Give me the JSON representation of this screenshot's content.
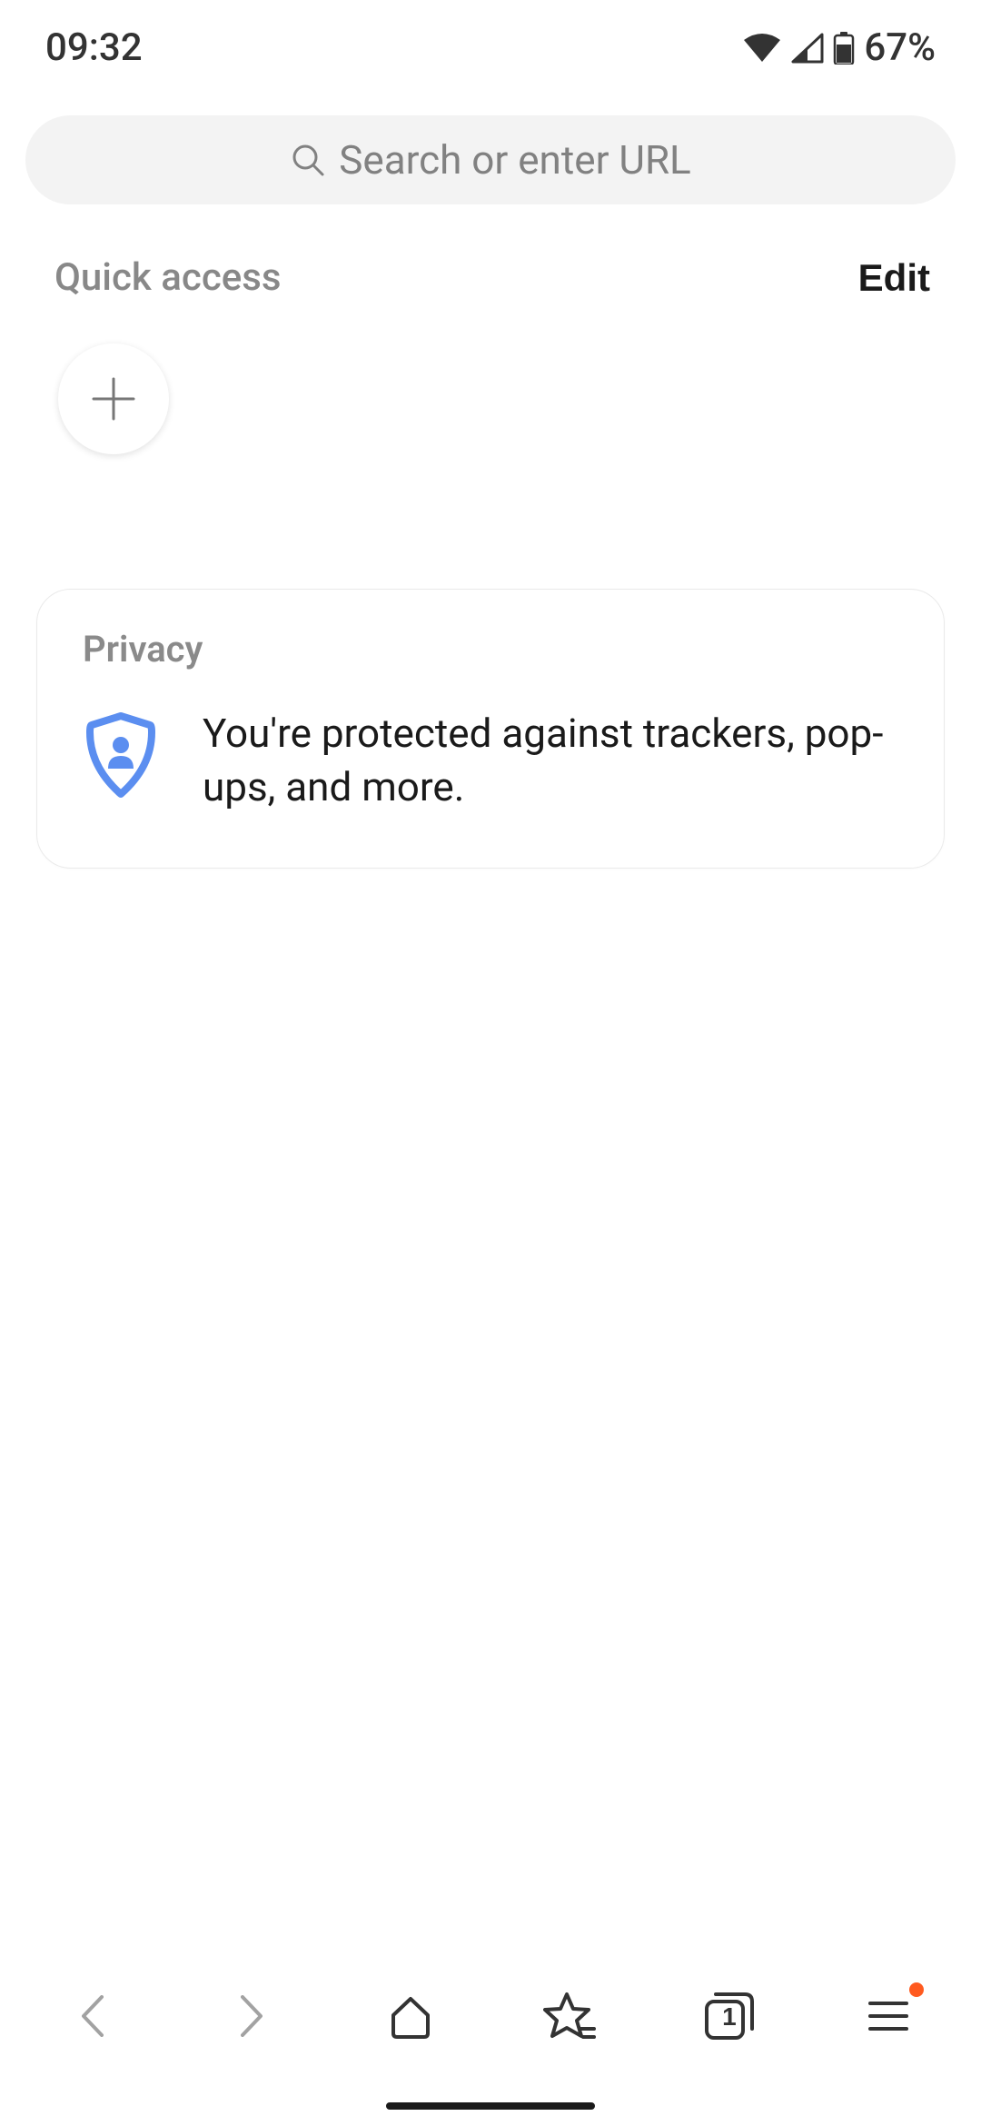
{
  "status": {
    "time": "09:32",
    "battery": "67%"
  },
  "search": {
    "placeholder": "Search or enter URL"
  },
  "quick_access": {
    "title": "Quick access",
    "edit_label": "Edit"
  },
  "privacy": {
    "title": "Privacy",
    "text": "You're protected against trackers, pop-ups, and more."
  },
  "nav": {
    "tab_count": "1"
  }
}
